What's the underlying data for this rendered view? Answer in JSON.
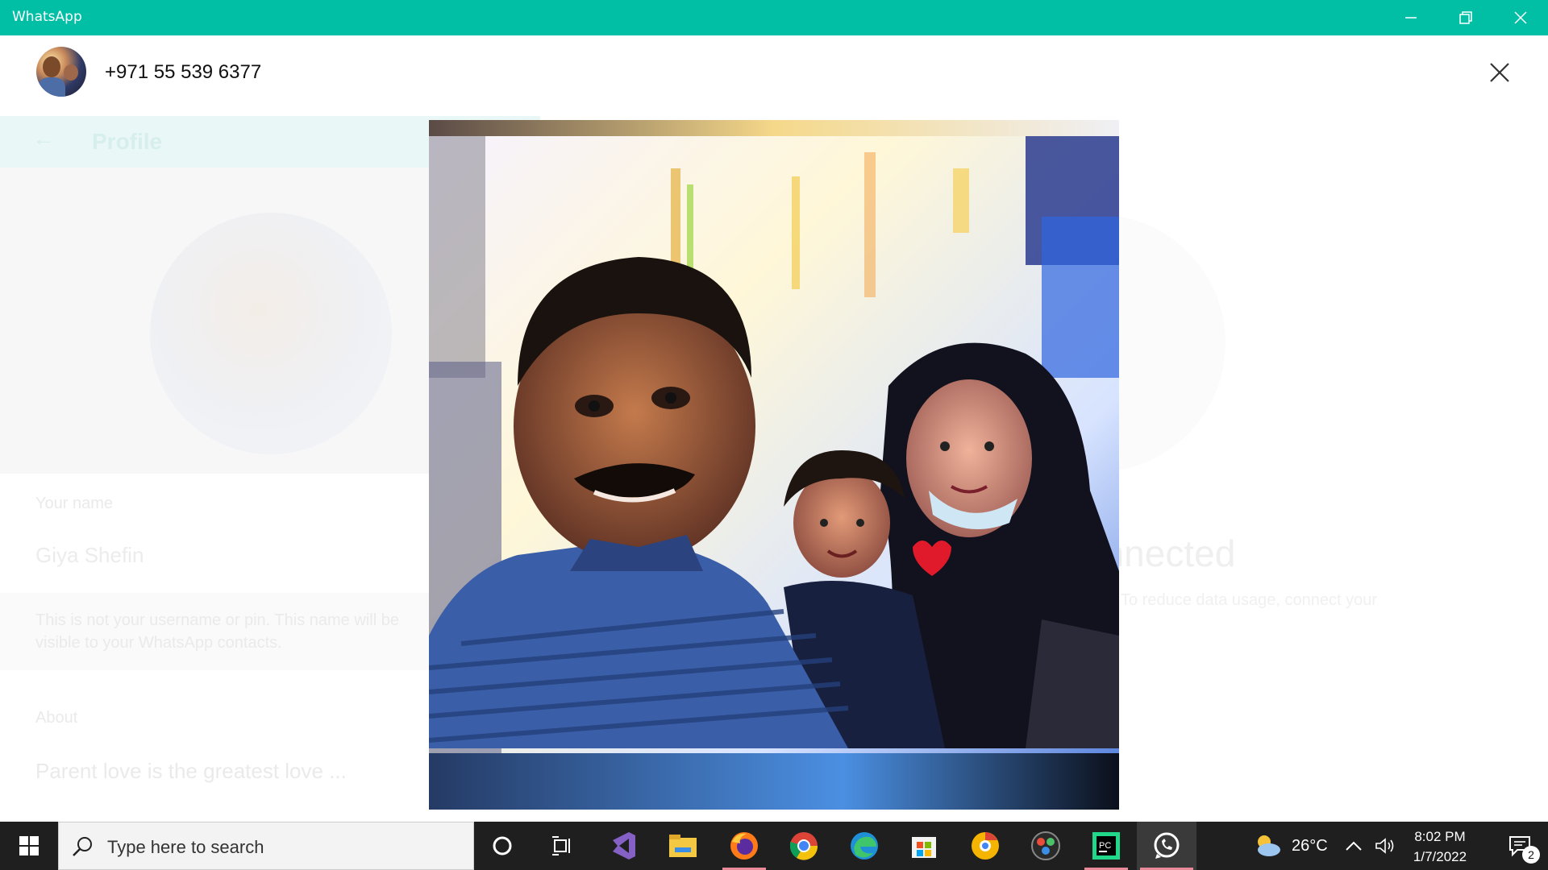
{
  "window": {
    "title": "WhatsApp"
  },
  "viewer": {
    "contact_number": "+971 55 539 6377"
  },
  "background_profile": {
    "header_title": "Profile",
    "name_label": "Your name",
    "name_value": "Giya Shefin",
    "name_hint": "This is not your username or pin. This name will be visible to your WhatsApp contacts.",
    "about_label": "About",
    "about_value": "Parent love is the greatest love ...",
    "right_title": "connected",
    "right_subtitle": "To reduce data usage, connect your"
  },
  "taskbar": {
    "search_placeholder": "Type here to search",
    "apps": [
      "cortana-icon",
      "task-view-icon",
      "visual-studio-icon",
      "file-explorer-icon",
      "firefox-icon",
      "chrome-icon",
      "edge-icon",
      "microsoft-store-icon",
      "chrome-canary-icon",
      "davinci-resolve-icon",
      "pycharm-icon",
      "whatsapp-icon"
    ],
    "weather_temp": "26°C",
    "time": "8:02 PM",
    "date": "1/7/2022",
    "notification_count": "2"
  },
  "colors": {
    "titlebar": "#00bfa5",
    "taskbar": "#1f1f1f"
  }
}
